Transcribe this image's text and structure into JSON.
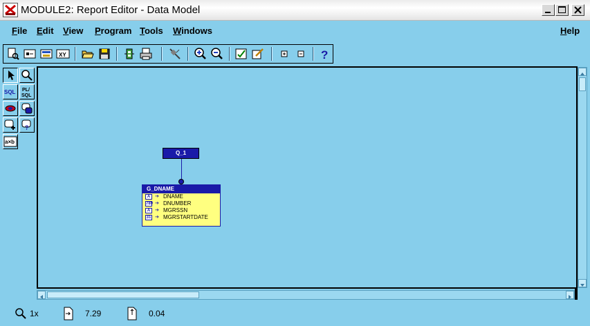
{
  "window": {
    "title": "MODULE2: Report Editor - Data Model",
    "icon": "report-editor-icon",
    "controls": [
      "minimize-icon",
      "maximize-icon",
      "close-icon"
    ]
  },
  "menu": {
    "file": "File",
    "edit": "Edit",
    "view": "View",
    "program": "Program",
    "tools": "Tools",
    "windows": "Windows",
    "help": "Help"
  },
  "toolbar": {
    "groups": [
      [
        "report-preview-icon",
        "record-icon",
        "record-preview-icon",
        "xy-icon"
      ],
      [
        "open-folder-icon",
        "save-icon"
      ],
      [
        "run-icon",
        "print-icon"
      ],
      [
        "plug-icon"
      ],
      [
        "zoom-in-icon",
        "zoom-out-icon"
      ],
      [
        "checklist-icon",
        "edit-pen-icon"
      ],
      [
        "expand-icon",
        "collapse-icon"
      ],
      [
        "help-icon"
      ]
    ]
  },
  "palette": {
    "tools": [
      {
        "name": "select-tool",
        "icon": "arrow-pointer-icon",
        "label": ""
      },
      {
        "name": "magnify-tool",
        "icon": "magnify-icon",
        "label": ""
      },
      {
        "name": "sql-query-tool",
        "icon": "sql-icon",
        "label": "SQL"
      },
      {
        "name": "plsql-tool",
        "icon": "plsql-icon",
        "label": "PL/ SQL"
      },
      {
        "name": "link-tool",
        "icon": "link-icon",
        "label": ""
      },
      {
        "name": "summary-tool",
        "icon": "summary-icon",
        "label": ""
      },
      {
        "name": "formula-tool",
        "icon": "formula-icon",
        "label": ""
      },
      {
        "name": "placeholder-tool",
        "icon": "placeholder-icon",
        "label": ""
      },
      {
        "name": "cross-product-tool",
        "icon": "cross-product-icon",
        "label": "a×b"
      }
    ]
  },
  "model": {
    "query_label": "Q_1",
    "group": {
      "name": "G_DNAME",
      "columns": [
        {
          "name": "DNAME",
          "type": "text-column-icon",
          "type_label": "A"
        },
        {
          "name": "DNUMBER",
          "type": "number-column-icon",
          "type_label": "789"
        },
        {
          "name": "MGRSSN",
          "type": "text-column-icon",
          "type_label": "A"
        },
        {
          "name": "MGRSTARTDATE",
          "type": "date-column-icon",
          "type_label": "31"
        }
      ]
    }
  },
  "status": {
    "zoom": "1x",
    "position_x": "7.29",
    "position_y": "0.04"
  },
  "colors": {
    "background": "#87ceeb",
    "object_blue": "#1a1aa8",
    "group_fill": "#ffff80"
  }
}
